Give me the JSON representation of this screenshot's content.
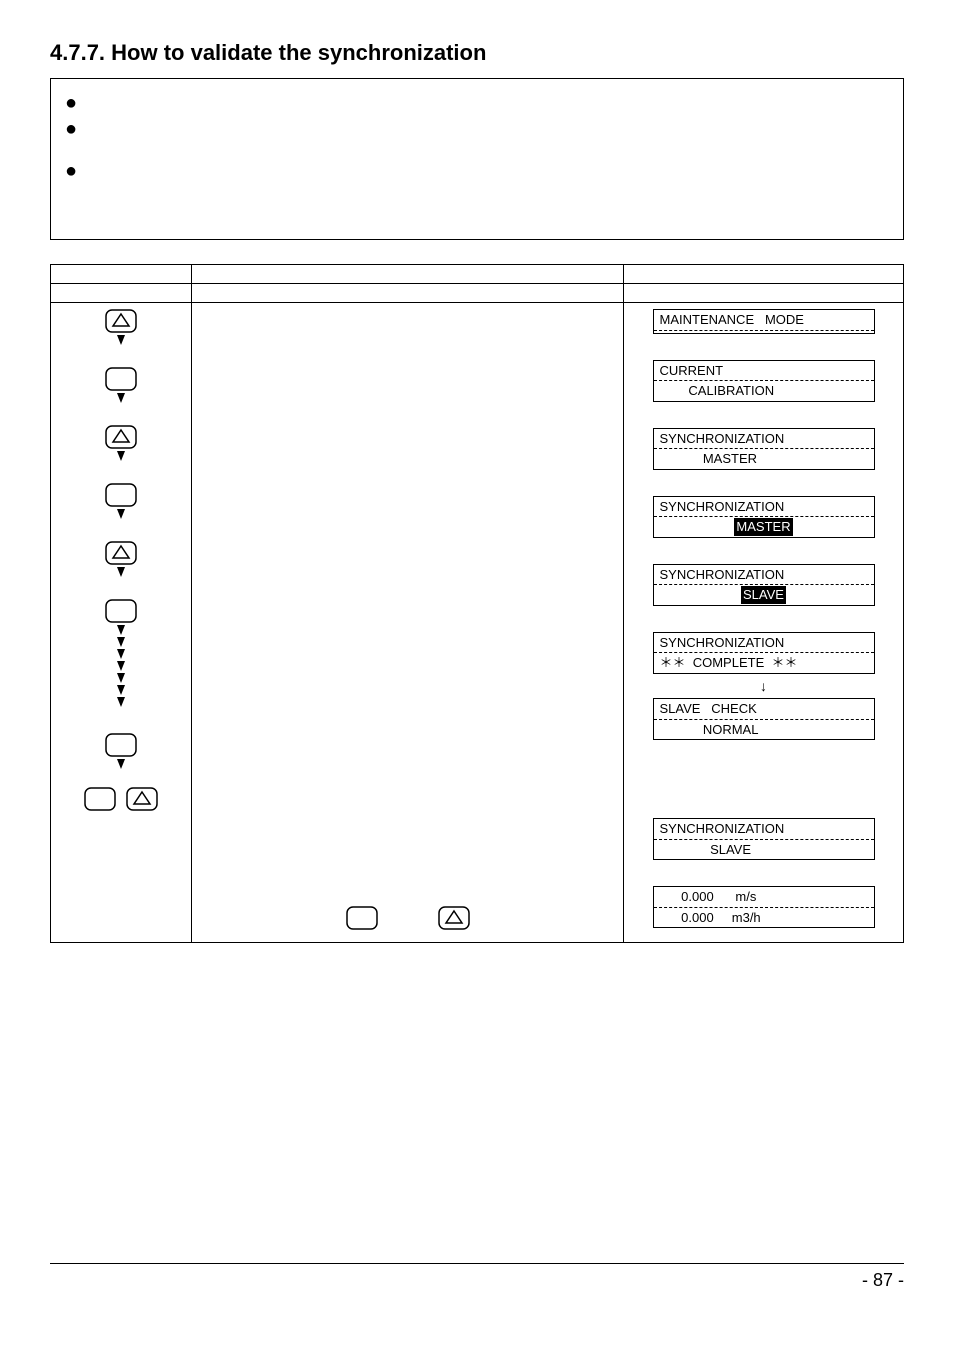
{
  "heading": "4.7.7. How to validate the synchronization",
  "screens": {
    "s1_r1": "MAINTENANCE   MODE",
    "s1_r2": "",
    "s2_r1": "CURRENT",
    "s2_r2": "        CALIBRATION",
    "s3_r1": "SYNCHRONIZATION",
    "s3_r2": "            MASTER",
    "s4_r1": "SYNCHRONIZATION",
    "s4_r2_label": "MASTER",
    "s5_r1": "SYNCHRONIZATION",
    "s5_r2_label": "SLAVE",
    "s6_r1": "SYNCHRONIZATION",
    "s6_r2": "＊＊  COMPLETE  ＊＊",
    "s7_r1": "SLAVE   CHECK",
    "s7_r2": "            NORMAL",
    "s8_r1": "SYNCHRONIZATION",
    "s8_r2": "              SLAVE",
    "s9_r1": "      0.000      m/s",
    "s9_r2": "      0.000     m3/h"
  },
  "page_number": "- 87 -"
}
